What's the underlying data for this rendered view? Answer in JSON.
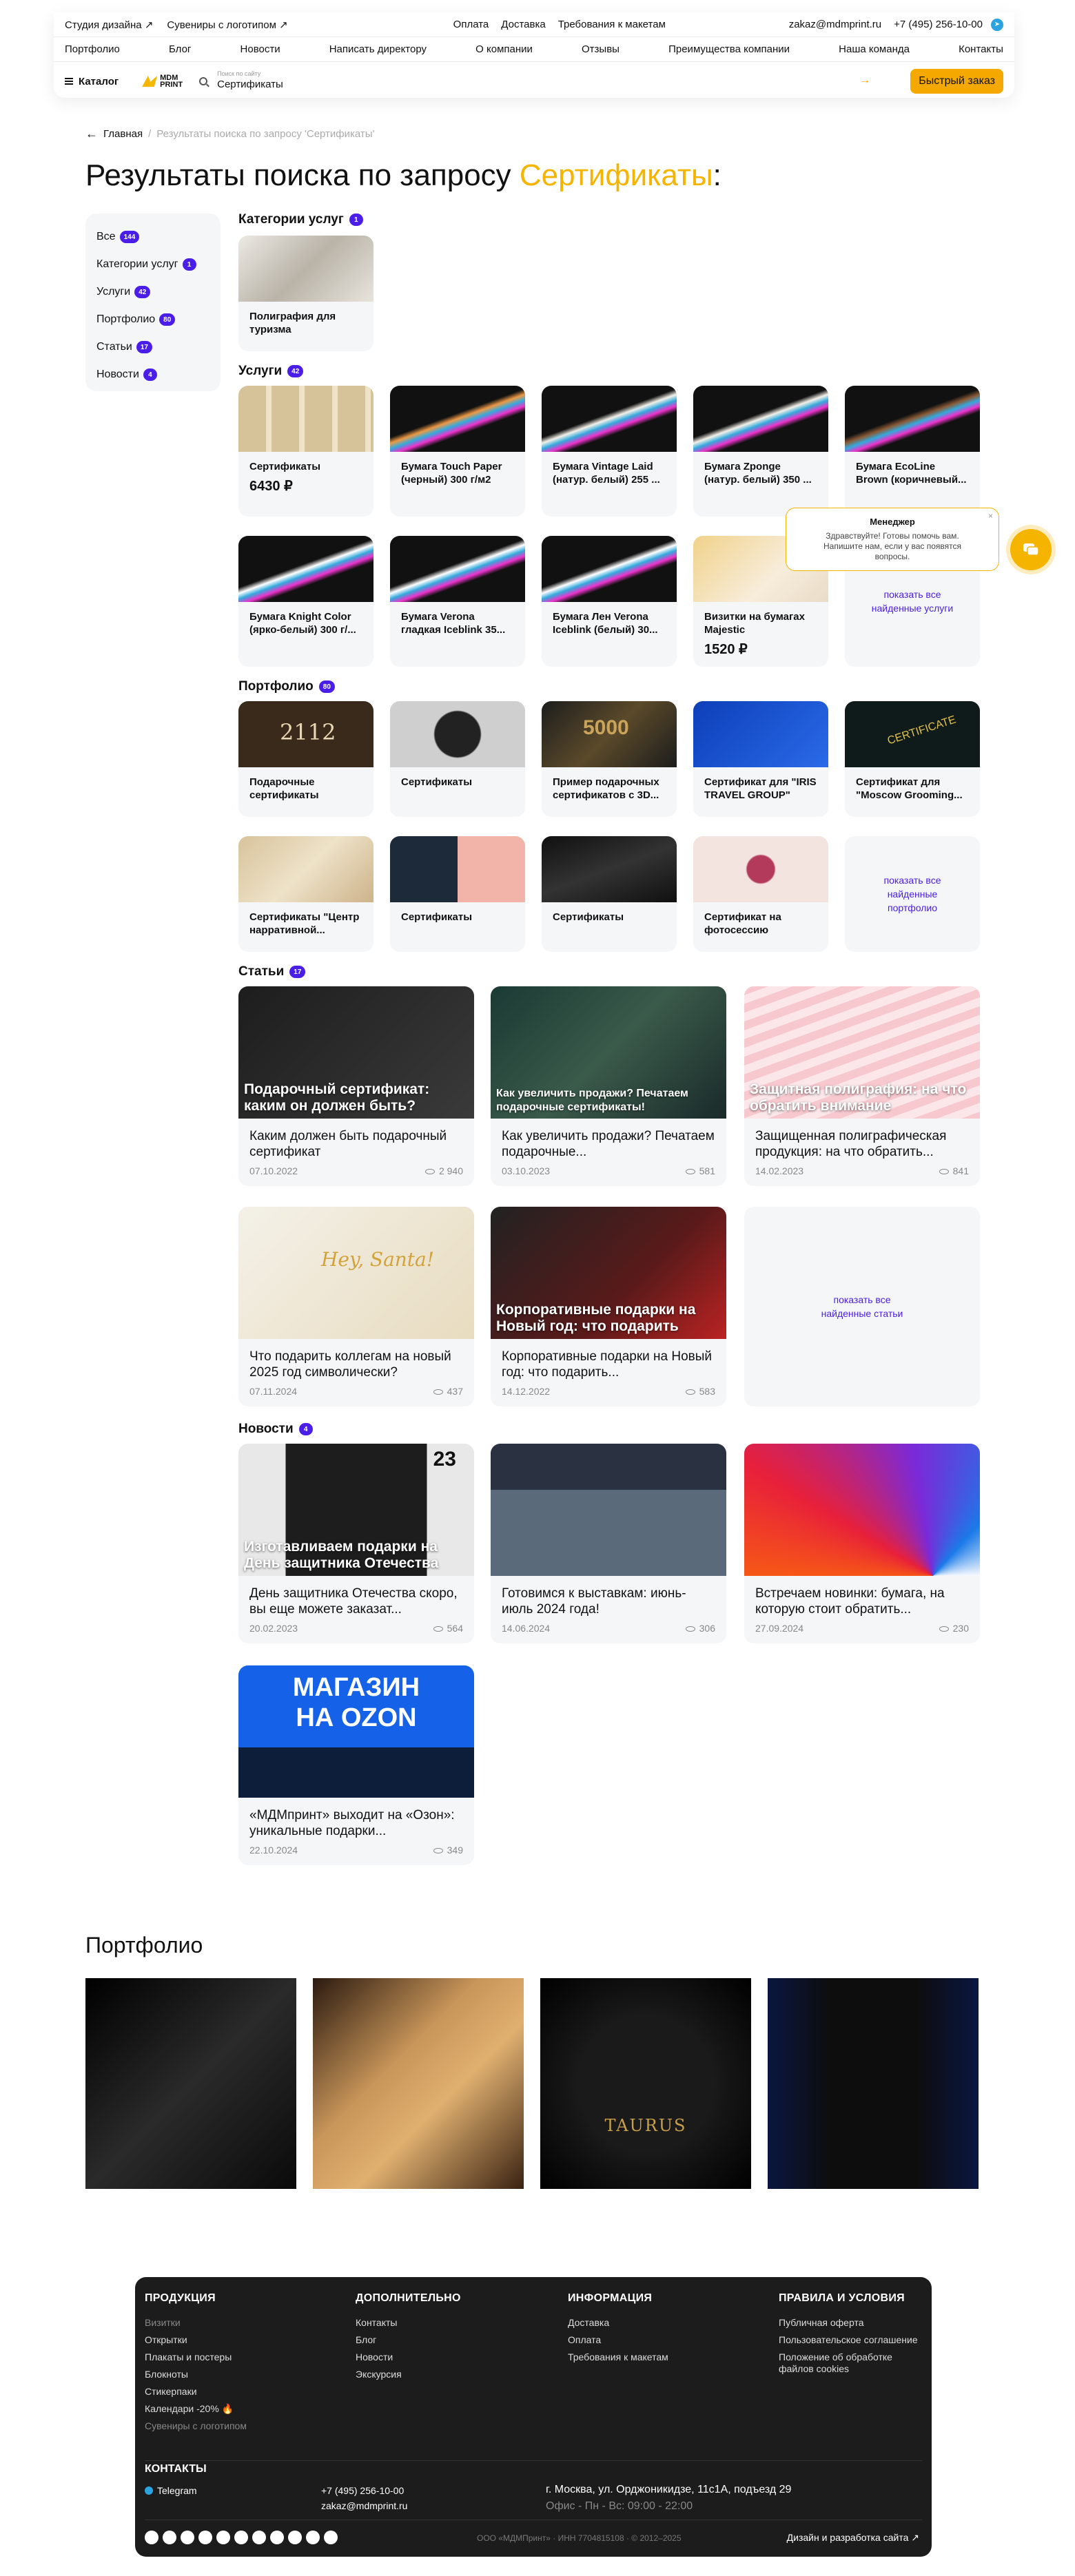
{
  "top_bar": {
    "studio": "Студия дизайна ↗",
    "souvenirs": "Сувениры с логотипом ↗",
    "payment": "Оплата",
    "delivery": "Доставка",
    "requirements": "Требования к макетам",
    "email": "zakaz@mdmprint.ru",
    "phone": "+7 (495) 256-10-00"
  },
  "nav": [
    "Портфолио",
    "Блог",
    "Новости",
    "Написать директору",
    "О компании",
    "Отзывы",
    "Преимущества компании",
    "Наша команда",
    "Контакты"
  ],
  "header": {
    "catalog": "Каталог",
    "logo_top": "MDM",
    "logo_bottom": "PRINT",
    "search_placeholder": "Поиск по сайту",
    "search_value": "Сертификаты",
    "quick_order": "Быстрый заказ"
  },
  "breadcrumb": {
    "home": "Главная",
    "sep": "/",
    "current": "Результаты поиска по запросу 'Сертификаты'"
  },
  "title": {
    "prefix": "Результаты поиска по запросу ",
    "query": "Сертификаты",
    "suffix": ":"
  },
  "sidebar": [
    {
      "label": "Все",
      "count": "144"
    },
    {
      "label": "Категории услуг",
      "count": "1"
    },
    {
      "label": "Услуги",
      "count": "42"
    },
    {
      "label": "Портфолио",
      "count": "80"
    },
    {
      "label": "Статьи",
      "count": "17"
    },
    {
      "label": "Новости",
      "count": "4"
    }
  ],
  "categories": {
    "label": "Категории услуг",
    "count": "1",
    "items": [
      {
        "title": "Полиграфия для туризма"
      }
    ]
  },
  "services": {
    "label": "Услуги",
    "count": "42",
    "items": [
      {
        "title": "Сертификаты",
        "price": "6430 ₽"
      },
      {
        "title": "Бумага Touch Paper (черный) 300 г/м2",
        "price": ""
      },
      {
        "title": "Бумага Vintage Laid (натур. белый) 255 ...",
        "price": ""
      },
      {
        "title": "Бумага Zponge (натур. белый) 350 ...",
        "price": ""
      },
      {
        "title": "Бумага EcoLine Brown (коричневый...",
        "price": ""
      },
      {
        "title": "Бумага Knight Color (ярко-белый) 300 г/...",
        "price": ""
      },
      {
        "title": "Бумага Verona гладкая Iceblink 35...",
        "price": ""
      },
      {
        "title": "Бумага Лен Verona Iceblink (белый) 30...",
        "price": ""
      },
      {
        "title": "Визитки на бумагах Majestic",
        "price": "1520 ₽"
      }
    ],
    "more": "показать все найденные услуги"
  },
  "portfolio": {
    "label": "Портфолио",
    "count": "80",
    "items": [
      {
        "title": "Подарочные сертификаты"
      },
      {
        "title": "Сертификаты"
      },
      {
        "title": "Пример подарочных сертификатов с 3D..."
      },
      {
        "title": "Сертификат для \"IRIS TRAVEL GROUP\""
      },
      {
        "title": "Сертификат для \"Moscow Grooming..."
      },
      {
        "title": "Сертификаты \"Центр нарративной..."
      },
      {
        "title": "Сертификаты"
      },
      {
        "title": "Сертификаты"
      },
      {
        "title": "Сертификат на фотосессию"
      }
    ],
    "more": "показать все найденные портфолио"
  },
  "articles": {
    "label": "Статьи",
    "count": "17",
    "items": [
      {
        "overlay": "Подарочный сертификат: каким он должен быть?",
        "title": "Каким должен быть подарочный сертификат",
        "date": "07.10.2022",
        "views": "2 940"
      },
      {
        "overlay": "Как увеличить продажи? Печатаем подарочные сертификаты!",
        "title": "Как увеличить продажи? Печатаем подарочные...",
        "date": "03.10.2023",
        "views": "581"
      },
      {
        "overlay": "Защитная полиграфия: на что обратить внимание",
        "title": "Защищенная полиграфическая продукция: на что обратить...",
        "date": "14.02.2023",
        "views": "841"
      },
      {
        "overlay": "",
        "title": "Что подарить коллегам на новый 2025 год символически?",
        "date": "07.11.2024",
        "views": "437"
      },
      {
        "overlay": "Корпоративные подарки на Новый год: что подарить",
        "title": "Корпоративные подарки на Новый год: что подарить...",
        "date": "14.12.2022",
        "views": "583"
      }
    ],
    "more": "показать все найденные статьи"
  },
  "news": {
    "label": "Новости",
    "count": "4",
    "items": [
      {
        "overlay": "Изготавливаем подарки на День защитника Отечества",
        "title": "День защитника Отечества скоро, вы еще можете заказат...",
        "date": "20.02.2023",
        "views": "564"
      },
      {
        "overlay": "",
        "title": "Готовимся к выставкам: июнь-июль 2024 года!",
        "date": "14.06.2024",
        "views": "306"
      },
      {
        "overlay": "",
        "title": "Встречаем новинки: бумага, на которую стоит обратить...",
        "date": "27.09.2024",
        "views": "230"
      },
      {
        "overlay": "",
        "title": "«МДМпринт» выходит на «Озон»: уникальные подарки...",
        "date": "22.10.2024",
        "views": "349",
        "banner_top": "МАГАЗИН",
        "banner_bottom": "НА OZON"
      }
    ]
  },
  "chat": {
    "name": "Менеджер",
    "message": "Здравствуйте! Готовы помочь вам. Напишите нам, если у вас появятся вопросы.",
    "close": "×"
  },
  "images": {
    "gift_cert_number": "2112",
    "cert_stamp": "5000",
    "cert_word": "CERTIFICATE",
    "greeting": "Hey, Santa!",
    "calendar_day": "23"
  },
  "bottom_portfolio": {
    "title": "Портфолио",
    "taurus": "TAURUS"
  },
  "footer": {
    "col1_title": "ПРОДУКЦИЯ",
    "col1": [
      "Визитки",
      "Открытки",
      "Плакаты и постеры",
      "Блокноты",
      "Стикерпаки",
      "Календари -20% 🔥",
      "Сувениры с логотипом"
    ],
    "col2_title": "ДОПОЛНИТЕЛЬНО",
    "col2": [
      "Контакты",
      "Блог",
      "Новости",
      "Экскурсия"
    ],
    "col3_title": "ИНФОРМАЦИЯ",
    "col3": [
      "Доставка",
      "Оплата",
      "Требования к макетам"
    ],
    "col4_title": "ПРАВИЛА И УСЛОВИЯ",
    "col4": [
      "Публичная оферта",
      "Пользовательское соглашение",
      "Положение об обработке файлов cookies"
    ],
    "contacts_title": "КОНТАКТЫ",
    "telegram": "Telegram",
    "phone": "+7 (495) 256-10-00",
    "email": "zakaz@mdmprint.ru",
    "address": "г. Москва, ул. Орджоникидзе, 11с1А, подъезд 29",
    "hours": "Офис - Пн - Вс: 09:00 - 22:00",
    "legal": "ООО «МДМПринт» · ИНН 7704815108 · © 2012–2025",
    "dev": "Дизайн и разработка сайта ↗"
  }
}
